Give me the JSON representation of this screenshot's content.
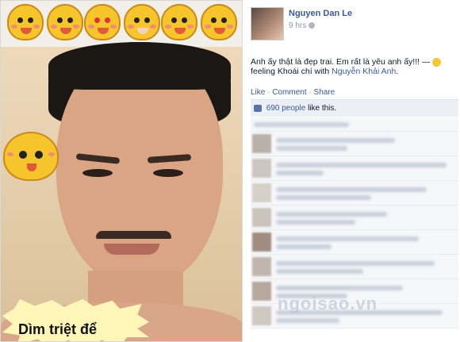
{
  "photo": {
    "caption": "Dìm triệt để",
    "stickers": [
      "cat-sticker-1",
      "cat-sticker-2",
      "cat-sticker-3",
      "cat-sticker-4",
      "cat-sticker-5",
      "cat-sticker-6"
    ]
  },
  "post": {
    "author": "Nguyen Dan Le",
    "time": "9 hrs",
    "status_text": "Anh ấy thật là đẹp trai. Em rất là yêu anh ấy!!! —",
    "feeling_prefix": "feeling Khoái chí with",
    "tagged_person": "Nguyễn Khải Anh",
    "feeling_suffix": ".",
    "actions": {
      "like": "Like",
      "comment": "Comment",
      "share": "Share",
      "separator": "·"
    },
    "likes": {
      "count": "690 people",
      "suffix": "like this."
    }
  },
  "watermark": "ngoisao.vn",
  "colors": {
    "fb_blue": "#3b5998",
    "like_bar": "#eceff5",
    "text": "#141823",
    "muted": "#9197a3"
  }
}
